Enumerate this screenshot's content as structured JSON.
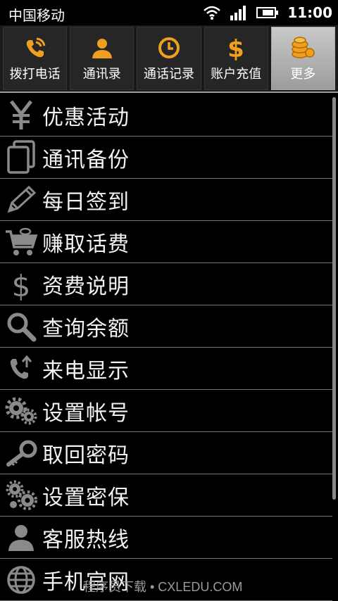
{
  "status": {
    "carrier": "中国移动",
    "time": "11:00"
  },
  "tabs": [
    {
      "label": "拨打电话",
      "icon": "phone-call-icon"
    },
    {
      "label": "通讯录",
      "icon": "contact-person-icon"
    },
    {
      "label": "通话记录",
      "icon": "clock-icon"
    },
    {
      "label": "账户充值",
      "icon": "dollar-icon"
    },
    {
      "label": "更多",
      "icon": "coins-icon",
      "active": true
    }
  ],
  "menu": [
    {
      "label": "优惠活动",
      "icon": "yen-icon"
    },
    {
      "label": "通讯备份",
      "icon": "copy-icon"
    },
    {
      "label": "每日签到",
      "icon": "pencil-icon"
    },
    {
      "label": "赚取话费",
      "icon": "cart-icon"
    },
    {
      "label": "资费说明",
      "icon": "dollar-icon"
    },
    {
      "label": "查询余额",
      "icon": "search-icon"
    },
    {
      "label": "来电显示",
      "icon": "incoming-call-icon"
    },
    {
      "label": "设置帐号",
      "icon": "gears-icon"
    },
    {
      "label": "取回密码",
      "icon": "key-icon"
    },
    {
      "label": "设置密保",
      "icon": "gears-security-icon"
    },
    {
      "label": "客服热线",
      "icon": "person-icon"
    },
    {
      "label": "手机官网",
      "icon": "globe-icon"
    }
  ],
  "watermark": "程序员下载 • CXLEDU.COM",
  "colors": {
    "tab_icon_orange": "#f0a020",
    "active_tab": "#b4b4b4",
    "divider": "#7a7a7a",
    "menu_icon_gray": "#8a8a8a"
  }
}
